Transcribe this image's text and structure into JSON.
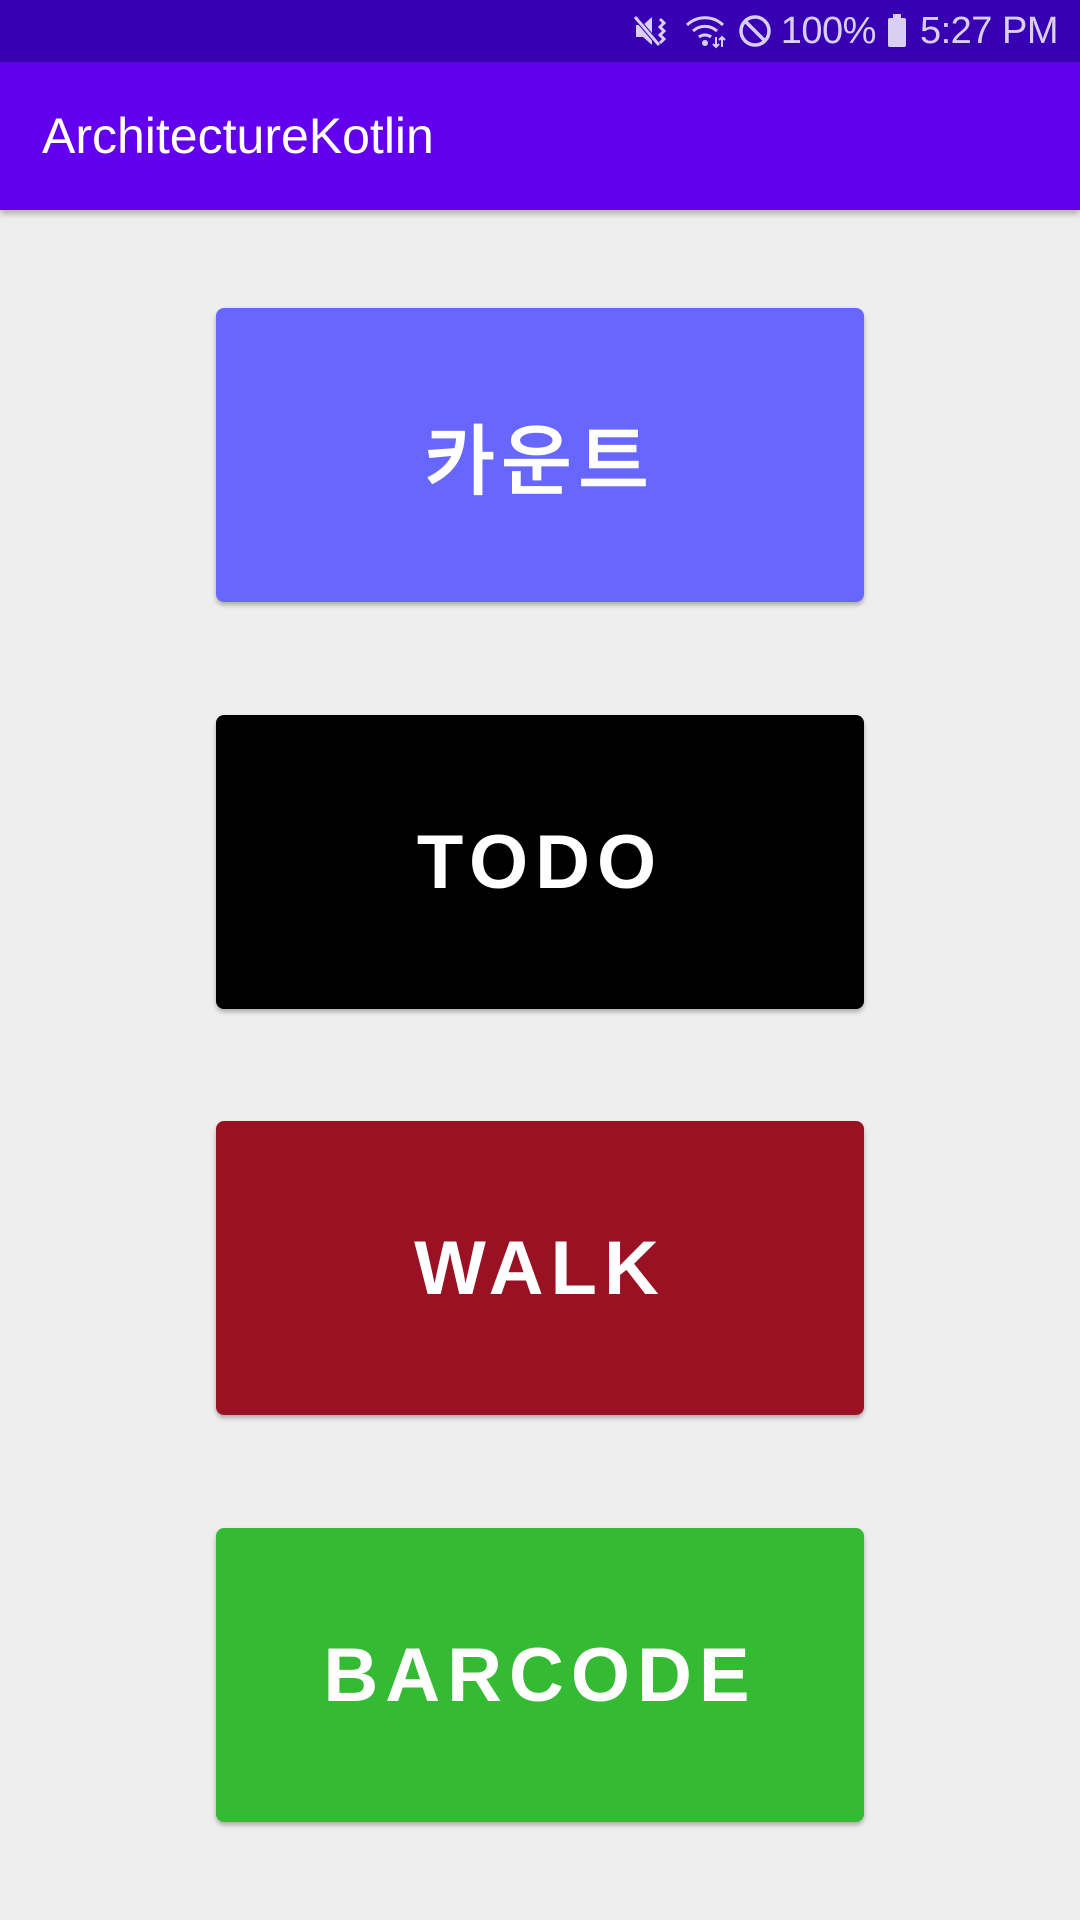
{
  "status_bar": {
    "icons": [
      "mute-vibrate-icon",
      "wifi-icon",
      "do-not-disturb-icon",
      "battery-icon"
    ],
    "battery_percent": "100%",
    "time": "5:27 PM",
    "background": "#3700b3"
  },
  "app_bar": {
    "title": "ArchitectureKotlin",
    "background": "#6200ee"
  },
  "buttons": [
    {
      "label": "카운트",
      "color": "#6767ff"
    },
    {
      "label": "TODO",
      "color": "#000000"
    },
    {
      "label": "WALK",
      "color": "#9b1124"
    },
    {
      "label": "BARCODE",
      "color": "#35bb33"
    }
  ],
  "background": "#eeeeee"
}
